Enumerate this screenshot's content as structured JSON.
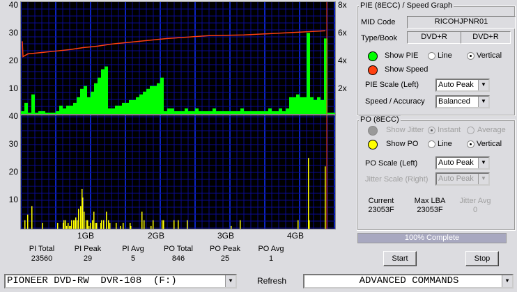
{
  "pie_group": {
    "title": "PIE (8ECC) / Speed Graph",
    "mid_label": "MID Code",
    "mid_value": "RICOHJPNR01",
    "type_label": "Type/Book",
    "type_value": "DVD+R",
    "book_value": "DVD+R",
    "show_pie": "Show PIE",
    "show_speed": "Show Speed",
    "line": "Line",
    "vertical": "Vertical",
    "scale_label": "PIE Scale (Left)",
    "scale_value": "Auto Peak",
    "speed_label": "Speed / Accuracy",
    "speed_value": "Balanced",
    "pie_color": "#00ff00",
    "speed_color": "#ff4010"
  },
  "po_group": {
    "title": "PO (8ECC)",
    "show_jitter": "Show Jitter",
    "instant": "Instant",
    "average": "Average",
    "show_po": "Show PO",
    "line": "Line",
    "vertical": "Vertical",
    "scale_label": "PO Scale (Left)",
    "scale_value": "Auto Peak",
    "jitter_scale_label": "Jitter Scale (Right)",
    "jitter_scale_value": "Auto Peak",
    "current_label": "Current",
    "current_value": "23053F",
    "maxlba_label": "Max LBA",
    "maxlba_value": "23053F",
    "jitter_avg_label": "Jitter Avg",
    "jitter_avg_value": "0",
    "po_color": "#ffff00"
  },
  "progress": {
    "label": "100% Complete",
    "value": 100
  },
  "buttons": {
    "start": "Start",
    "stop": "Stop",
    "refresh": "Refresh"
  },
  "drive": {
    "value": "PIONEER DVD-RW  DVR-108  (F:)"
  },
  "advanced": {
    "value": "ADVANCED COMMANDS"
  },
  "stats": [
    {
      "label": "PI Total",
      "value": "23560"
    },
    {
      "label": "PI Peak",
      "value": "29"
    },
    {
      "label": "PI Avg",
      "value": "5"
    },
    {
      "label": "PO Total",
      "value": "846"
    },
    {
      "label": "PO Peak",
      "value": "25"
    },
    {
      "label": "PO Avg",
      "value": "1"
    }
  ],
  "chart_data": [
    {
      "type": "bar",
      "title": "PIE / Speed",
      "ylim": [
        0,
        40
      ],
      "y2lim": [
        0,
        8
      ],
      "yticks": [
        "40",
        "30",
        "20",
        "10"
      ],
      "y2ticks": [
        "8x",
        "6x",
        "4x",
        "2x"
      ],
      "x_unit": "GB",
      "x_step": 0.05,
      "pie_values": [
        1,
        4,
        0,
        7,
        0,
        1,
        1,
        0,
        0,
        0,
        1,
        3,
        2,
        3,
        3,
        4,
        6,
        9,
        10,
        6,
        8,
        11,
        13,
        16,
        17,
        2,
        2,
        3,
        3,
        4,
        4,
        5,
        5,
        6,
        7,
        8,
        9,
        10,
        10,
        11,
        13,
        1,
        2,
        2,
        1,
        1,
        1,
        2,
        1,
        1,
        2,
        1,
        1,
        1,
        1,
        2,
        1,
        1,
        1,
        1,
        1,
        1,
        1,
        2,
        1,
        1,
        1,
        1,
        1,
        1,
        1,
        2,
        1,
        1,
        2,
        1,
        2,
        6,
        6,
        7,
        6,
        6,
        29,
        6,
        5,
        6,
        5,
        27,
        0,
        0
      ],
      "speed": [
        [
          0.02,
          5.2
        ],
        [
          0.03,
          4.1
        ],
        [
          0.1,
          4.3
        ],
        [
          0.3,
          4.4
        ],
        [
          0.5,
          4.5
        ],
        [
          0.7,
          4.6
        ],
        [
          0.9,
          4.75
        ],
        [
          1.1,
          4.85
        ],
        [
          1.3,
          5.0
        ],
        [
          1.5,
          5.1
        ],
        [
          1.7,
          5.2
        ],
        [
          1.9,
          5.3
        ],
        [
          2.1,
          5.4
        ],
        [
          2.4,
          5.5
        ],
        [
          2.7,
          5.6
        ],
        [
          3.2,
          5.65
        ],
        [
          3.6,
          5.75
        ],
        [
          4.0,
          5.85
        ],
        [
          4.37,
          5.95
        ]
      ],
      "end_marker_gb": 4.39
    },
    {
      "type": "bar",
      "title": "PO",
      "ylim": [
        0,
        40
      ],
      "yticks": [
        "40",
        "30",
        "20",
        "10"
      ],
      "xticks": [
        "1GB",
        "2GB",
        "3GB",
        "4GB"
      ],
      "x_unit": "GB",
      "po_points": [
        [
          0.05,
          3
        ],
        [
          0.09,
          5
        ],
        [
          0.15,
          8
        ],
        [
          0.3,
          2
        ],
        [
          0.52,
          2
        ],
        [
          0.6,
          2
        ],
        [
          0.61,
          3
        ],
        [
          0.63,
          3
        ],
        [
          0.65,
          1
        ],
        [
          0.67,
          2
        ],
        [
          0.69,
          1
        ],
        [
          0.71,
          1
        ],
        [
          0.72,
          3
        ],
        [
          0.75,
          3
        ],
        [
          0.77,
          3
        ],
        [
          0.78,
          4
        ],
        [
          0.8,
          3
        ],
        [
          0.82,
          7
        ],
        [
          0.85,
          8
        ],
        [
          0.87,
          14
        ],
        [
          0.88,
          11
        ],
        [
          0.9,
          6
        ],
        [
          0.93,
          3
        ],
        [
          0.95,
          3
        ],
        [
          0.97,
          1
        ],
        [
          0.99,
          2
        ],
        [
          1.02,
          3
        ],
        [
          1.04,
          6
        ],
        [
          1.06,
          2
        ],
        [
          1.08,
          2
        ],
        [
          1.14,
          2
        ],
        [
          1.15,
          3
        ],
        [
          1.18,
          3
        ],
        [
          1.22,
          6
        ],
        [
          1.25,
          3
        ],
        [
          1.27,
          2
        ],
        [
          1.36,
          2
        ],
        [
          1.42,
          1
        ],
        [
          1.46,
          2
        ],
        [
          1.56,
          2
        ],
        [
          1.57,
          1
        ],
        [
          1.73,
          6
        ],
        [
          1.76,
          3
        ],
        [
          1.86,
          1
        ],
        [
          1.89,
          3
        ],
        [
          2.02,
          3
        ],
        [
          2.04,
          3
        ],
        [
          2.19,
          3
        ],
        [
          2.25,
          3
        ],
        [
          2.38,
          3
        ],
        [
          3.01,
          1
        ],
        [
          3.14,
          3
        ],
        [
          3.97,
          3
        ],
        [
          4.12,
          25
        ],
        [
          4.13,
          3
        ],
        [
          4.36,
          22
        ]
      ]
    }
  ]
}
